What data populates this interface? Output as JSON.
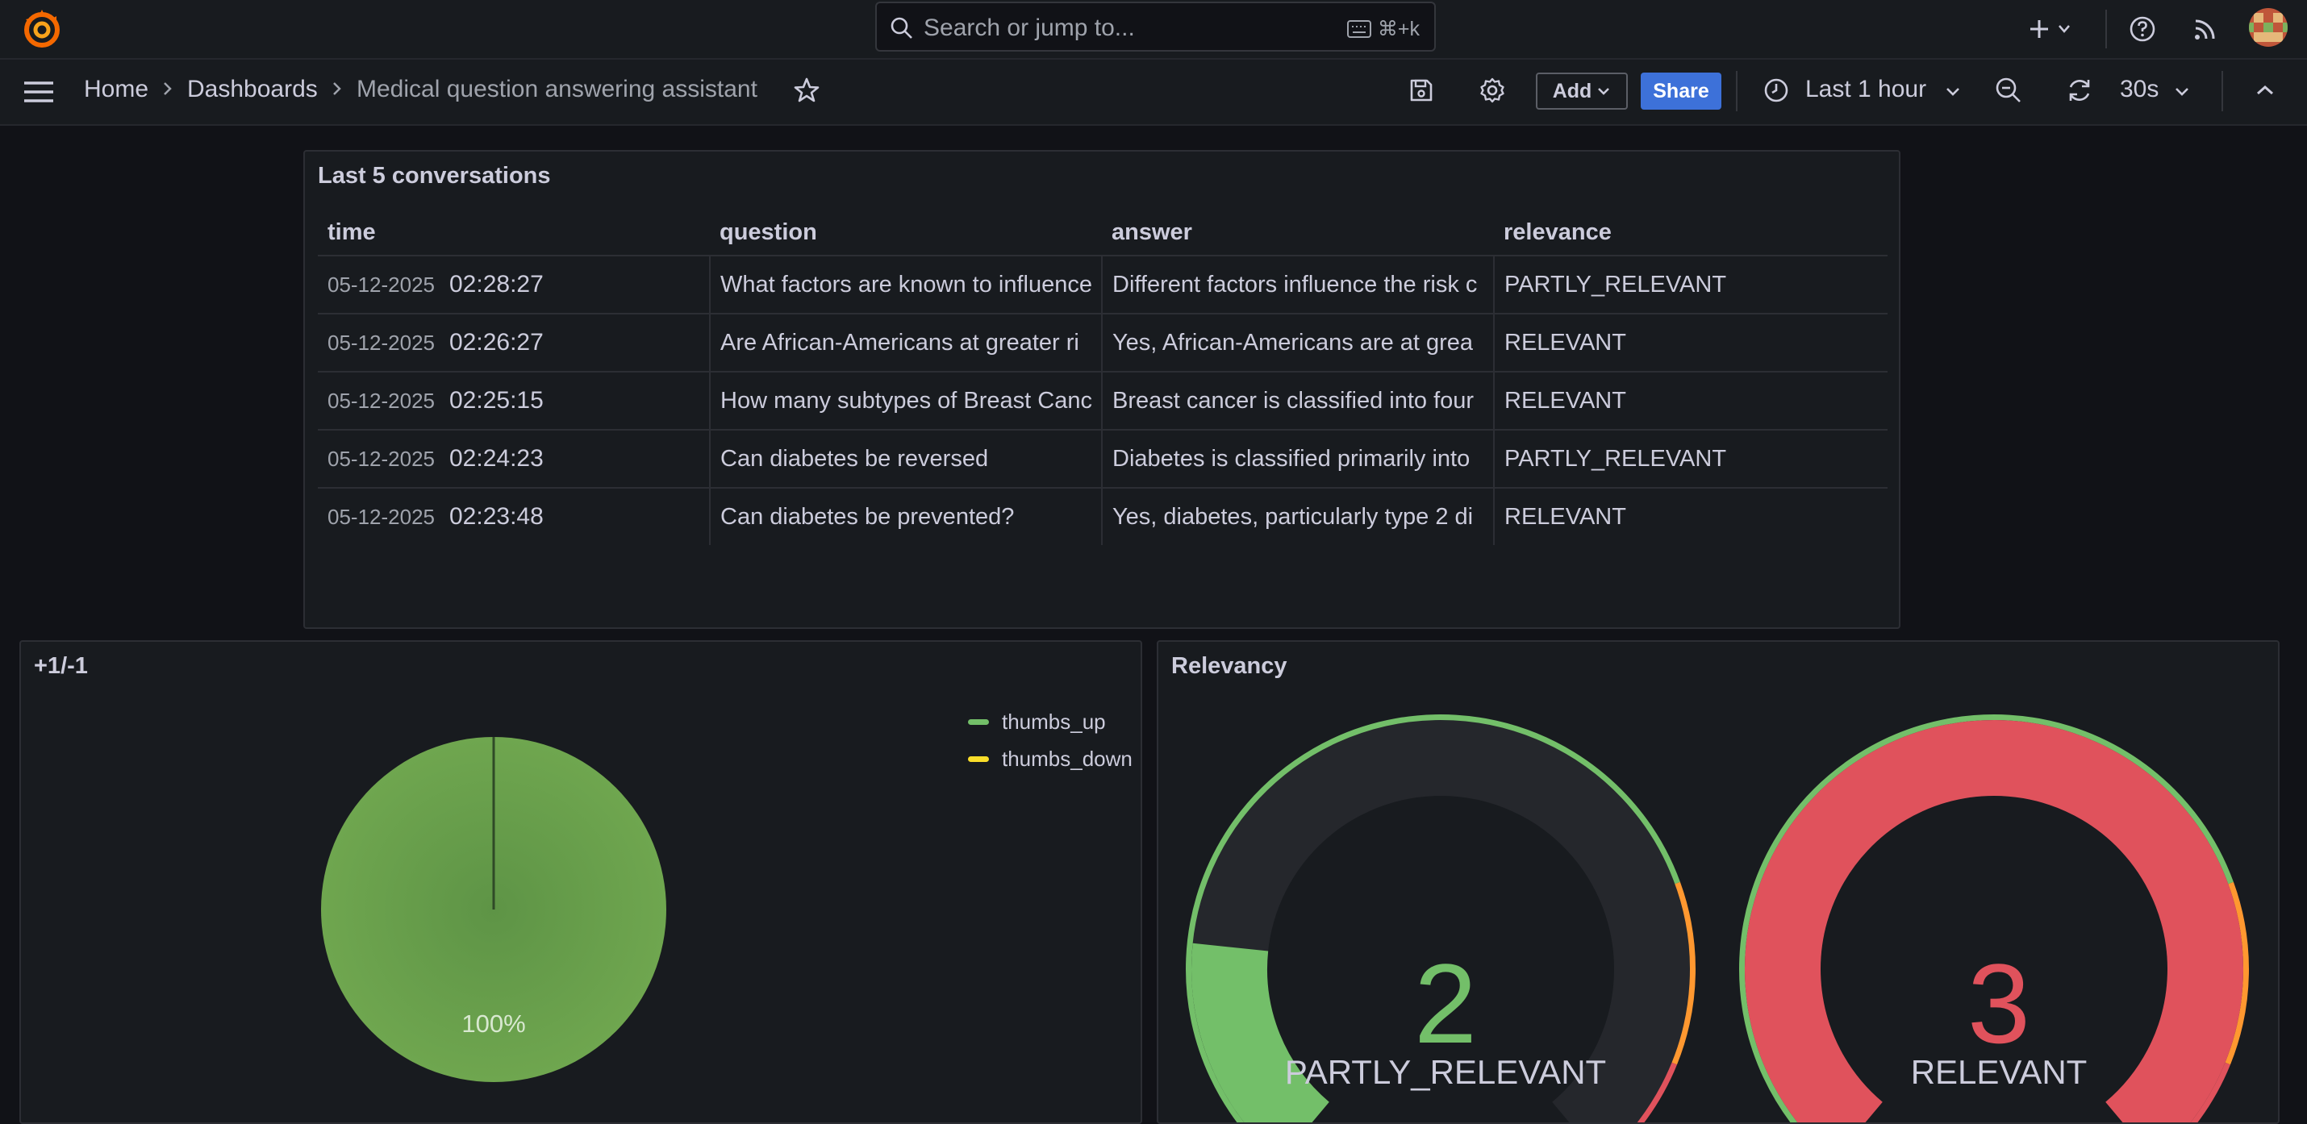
{
  "topbar": {
    "search_placeholder": "Search or jump to...",
    "search_shortcut": "⌘+k"
  },
  "breadcrumb": {
    "home": "Home",
    "dashboards": "Dashboards",
    "current": "Medical question answering assistant"
  },
  "toolbar": {
    "add_label": "Add",
    "share_label": "Share",
    "time_range": "Last 1 hour",
    "refresh_interval": "30s"
  },
  "conversations": {
    "title": "Last 5 conversations",
    "columns": [
      "time",
      "question",
      "answer",
      "relevance"
    ],
    "rows": [
      {
        "date": "05-12-2025",
        "time": "02:28:27",
        "question": "What factors are known to influence",
        "answer": "Different factors influence the risk c",
        "relevance": "PARTLY_RELEVANT"
      },
      {
        "date": "05-12-2025",
        "time": "02:26:27",
        "question": "Are African-Americans at greater ri",
        "answer": "Yes, African-Americans are at grea",
        "relevance": "RELEVANT"
      },
      {
        "date": "05-12-2025",
        "time": "02:25:15",
        "question": "How many subtypes of Breast Canc",
        "answer": "Breast cancer is classified into four",
        "relevance": "RELEVANT"
      },
      {
        "date": "05-12-2025",
        "time": "02:24:23",
        "question": "Can diabetes be reversed",
        "answer": "Diabetes is classified primarily into",
        "relevance": "PARTLY_RELEVANT"
      },
      {
        "date": "05-12-2025",
        "time": "02:23:48",
        "question": "Can diabetes be prevented?",
        "answer": "Yes, diabetes, particularly type 2 di",
        "relevance": "RELEVANT"
      }
    ]
  },
  "feedback": {
    "title": "+1/-1",
    "slice_label": "100%",
    "legend": [
      {
        "name": "thumbs_up",
        "color": "#73bf69"
      },
      {
        "name": "thumbs_down",
        "color": "#fade2a"
      }
    ]
  },
  "relevancy": {
    "title": "Relevancy"
  },
  "chart_data": [
    {
      "type": "pie",
      "title": "+1/-1",
      "series": [
        {
          "name": "thumbs_up",
          "value": 1,
          "percent": 100,
          "color": "#73bf69"
        },
        {
          "name": "thumbs_down",
          "value": 0,
          "percent": 0,
          "color": "#fade2a"
        }
      ]
    },
    {
      "type": "gauge",
      "title": "Relevancy",
      "series": [
        {
          "name": "PARTLY_RELEVANT",
          "value": 2,
          "value_label": "2",
          "min": 0,
          "max": 10,
          "color": "#73bf69"
        },
        {
          "name": "RELEVANT",
          "value": 3,
          "value_label": "3",
          "min": 0,
          "max": 3,
          "color": "#e0525c"
        }
      ],
      "thresholds": [
        {
          "color": "#73bf69"
        },
        {
          "color": "#ff9830"
        },
        {
          "color": "#e0525c"
        }
      ]
    }
  ]
}
